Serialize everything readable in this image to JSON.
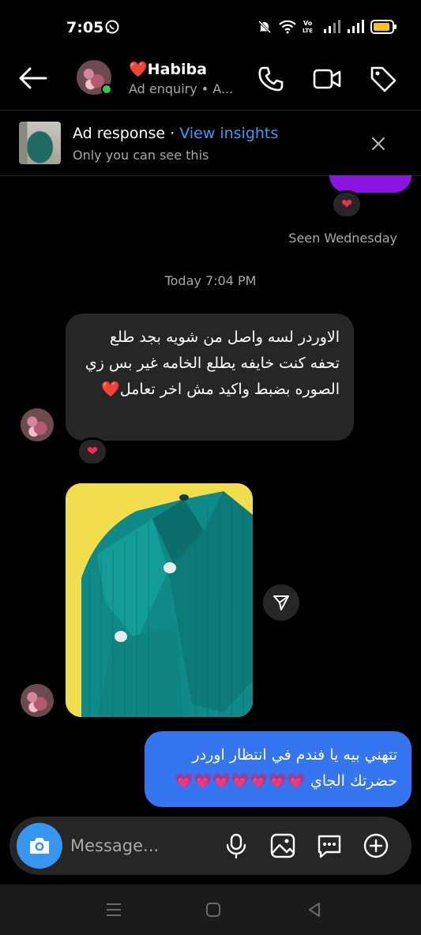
{
  "status_bar": {
    "time": "7:05",
    "battery_color": "#f6c21b"
  },
  "header": {
    "name": "Habiba",
    "name_heart": "❤️",
    "subtitle": "Ad enquiry • A...",
    "icons": [
      "back-arrow-icon",
      "phone-icon",
      "video-camera-icon",
      "tag-icon"
    ]
  },
  "ad_banner": {
    "title": "Ad response",
    "separator": " · ",
    "link": "View insights",
    "subtitle": "Only you can see this"
  },
  "chat": {
    "reaction_top": "❤",
    "seen": "Seen Wednesday",
    "timestamp": "Today 7:04 PM",
    "incoming_message": "الاوردر لسه واصل من شويه بجد طلع تحفه كنت خايفه يطلع الخامه غير بس زي الصوره بضبط واكيد مش اخر تعامل❤️",
    "incoming_reaction": "❤",
    "outgoing_message": "تتهني بيه يا فندم في انتظار اوردر حضرتك الجاي",
    "outgoing_hearts": "💗💗💗💗💗💗💗"
  },
  "composer": {
    "placeholder": "Message..."
  },
  "colors": {
    "accent_blue": "#3797f0",
    "outgoing_bubble": "#3576f0",
    "incoming_bubble": "#262626",
    "purple_bubble": "#8b14e0",
    "online_green": "#39c94e"
  }
}
